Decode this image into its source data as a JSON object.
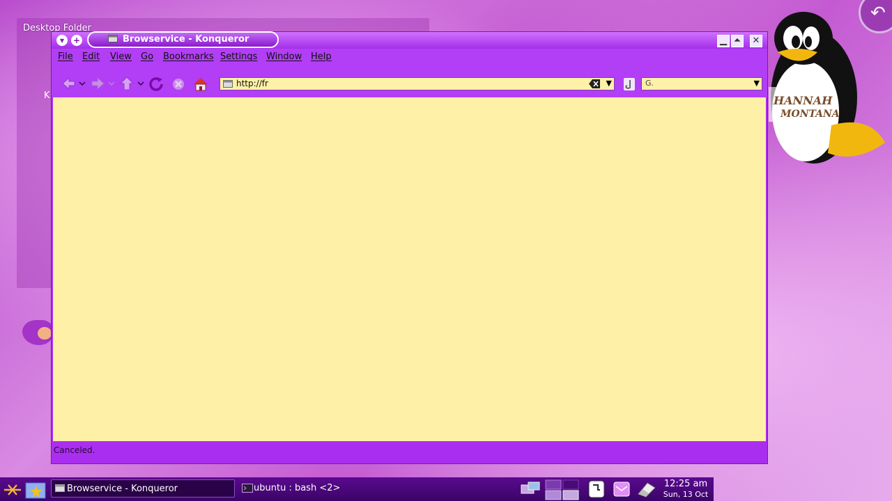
{
  "desktop": {
    "folder_title": "Desktop Folder",
    "folder_partial_letter": "K"
  },
  "window": {
    "title": "Browservice - Konqueror",
    "menu": [
      "File",
      "Edit",
      "View",
      "Go",
      "Bookmarks",
      "Settings",
      "Window",
      "Help"
    ],
    "url": "http://fr",
    "search_placeholder": "",
    "status": "Canceled."
  },
  "taskbar": {
    "tasks": [
      {
        "label": "Browservice - Konqueror",
        "active": true
      },
      {
        "label": "ubuntu : bash <2>",
        "active": false
      }
    ],
    "clock": {
      "time": "12:25 am",
      "date": "Sun, 13 Oct"
    }
  },
  "colors": {
    "window_purple": "#aa2ef0",
    "content_bg": "#fff0a8",
    "taskbar": "#3b0467"
  },
  "icons": [
    "back-icon",
    "forward-icon",
    "up-icon",
    "reload-icon",
    "stop-icon",
    "home-icon",
    "clear-icon",
    "go-icon",
    "search-icon"
  ]
}
